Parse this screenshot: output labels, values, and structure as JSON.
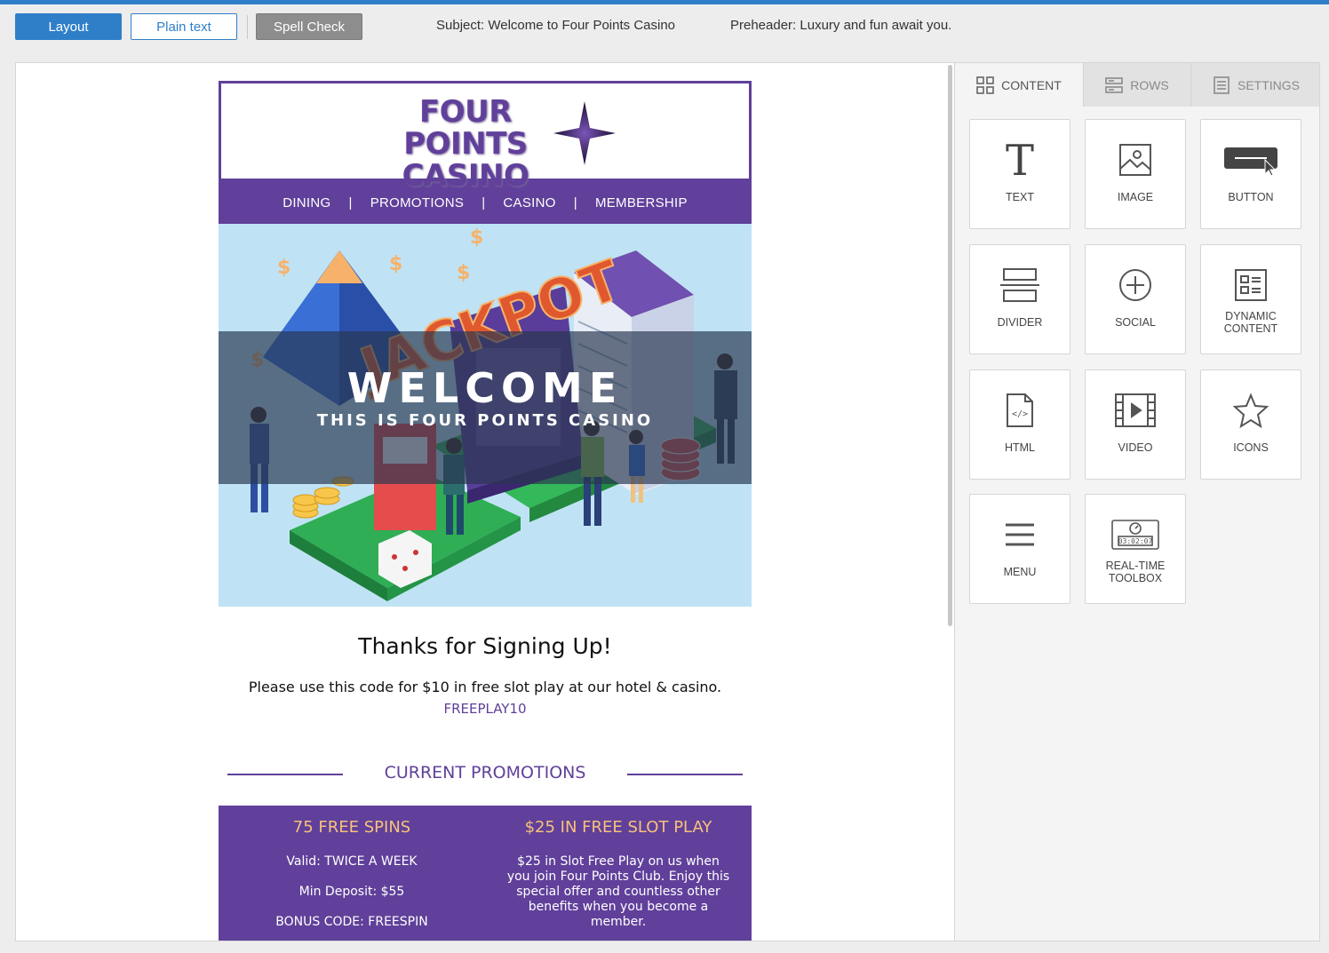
{
  "toolbar": {
    "layout_label": "Layout",
    "plain_label": "Plain text",
    "spell_label": "Spell Check",
    "subject": "Subject: Welcome to Four Points Casino",
    "preheader": "Preheader: Luxury and fun await you."
  },
  "email": {
    "logo_line1": "FOUR POINTS",
    "logo_line2": "CASINO",
    "nav": [
      "DINING",
      "PROMOTIONS",
      "CASINO",
      "MEMBERSHIP"
    ],
    "nav_separator": "|",
    "hero_title": "WELCOME",
    "hero_subtitle": "THIS IS FOUR POINTS CASINO",
    "hero_sign_text": "JACKPOT",
    "thanks": "Thanks for Signing Up!",
    "code_text": "Please use this code for $10 in free slot play at our hotel & casino.",
    "code": "FREEPLAY10",
    "promotions_title": "CURRENT PROMOTIONS",
    "promos": [
      {
        "title": "75 FREE SPINS",
        "lines": [
          "Valid: TWICE A WEEK",
          "Min Deposit: $55",
          "BONUS CODE: FREESPIN"
        ]
      },
      {
        "title": "$25 IN FREE SLOT PLAY",
        "description": "$25 in Slot Free Play on us when you join Four Points Club. Enjoy this special offer and countless other benefits when you become a member."
      }
    ]
  },
  "panel": {
    "tabs": [
      {
        "label": "CONTENT",
        "icon": "grid-icon",
        "active": true
      },
      {
        "label": "ROWS",
        "icon": "rows-icon",
        "active": false
      },
      {
        "label": "SETTINGS",
        "icon": "settings-icon",
        "active": false
      }
    ],
    "tiles": [
      {
        "label": "TEXT",
        "icon": "text-icon"
      },
      {
        "label": "IMAGE",
        "icon": "image-icon"
      },
      {
        "label": "BUTTON",
        "icon": "button-icon"
      },
      {
        "label": "DIVIDER",
        "icon": "divider-icon"
      },
      {
        "label": "SOCIAL",
        "icon": "social-plus-icon"
      },
      {
        "label": "DYNAMIC CONTENT",
        "icon": "dynamic-content-icon"
      },
      {
        "label": "HTML",
        "icon": "html-file-icon"
      },
      {
        "label": "VIDEO",
        "icon": "video-icon"
      },
      {
        "label": "ICONS",
        "icon": "star-icon"
      },
      {
        "label": "MENU",
        "icon": "hamburger-menu-icon"
      },
      {
        "label": "REAL-TIME TOOLBOX",
        "icon": "countdown-timer-icon",
        "timer": "03:02:07"
      }
    ]
  },
  "colors": {
    "brand_blue": "#2f7fc8",
    "casino_purple": "#60409a",
    "promo_title": "#f9c17a"
  }
}
